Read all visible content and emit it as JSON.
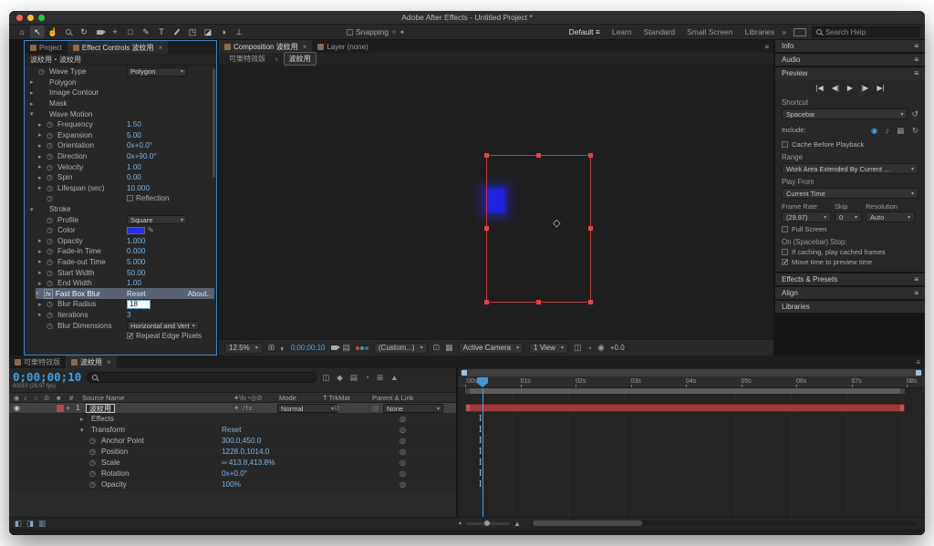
{
  "window": {
    "title": "Adobe After Effects - Untitled Project *"
  },
  "icons": {
    "panel-menu": "≡",
    "close": "×",
    "chevron-down": "▾",
    "chevron-right": "▸",
    "chevron-left": "‹",
    "overflow": "»",
    "stopwatch": "◷",
    "pickwhip": "◎",
    "link": "∞",
    "reset": "↺",
    "eye": "◉",
    "audio": "♪",
    "solo": "○",
    "lock": "⊘",
    "label": "■",
    "overlays": "▦",
    "refresh": "↻",
    "eyedropper": "✎",
    "fx-badge": "fx",
    "switches": "✦\\fx◔◎⊘",
    "layer-switches": "✦ /fx",
    "anchor-star": "◇",
    "grid": "⊞",
    "mask-vis": "◐",
    "show-snapshot": "▤",
    "roi": "⊡",
    "tgrid": "▦",
    "pixel-aspect": "◫",
    "fast-previews": "◔",
    "aperture": "◉",
    "snap-a": "✧",
    "snap-b": "✦"
  },
  "toolbar": {
    "tools": [
      {
        "name": "home-tool",
        "glyph": "⌂"
      },
      {
        "name": "selection-tool",
        "glyph": "↖",
        "active": true
      },
      {
        "name": "hand-tool",
        "glyph": "☝"
      },
      {
        "name": "zoom-tool",
        "shape": "mag"
      },
      {
        "name": "orbit-camera-tool",
        "glyph": "↻"
      },
      {
        "name": "camera-tool",
        "shape": "cam"
      },
      {
        "name": "pan-behind-tool",
        "glyph": "+"
      },
      {
        "name": "shape-tool",
        "glyph": "□"
      },
      {
        "name": "pen-tool",
        "glyph": "✎"
      },
      {
        "name": "type-tool",
        "glyph": "T"
      },
      {
        "name": "brush-tool",
        "shape": "brush"
      },
      {
        "name": "clone-stamp-tool",
        "glyph": "◳"
      },
      {
        "name": "eraser-tool",
        "glyph": "◪"
      },
      {
        "name": "roto-brush-tool",
        "glyph": "◑"
      },
      {
        "name": "puppet-pin-tool",
        "glyph": "⊥"
      }
    ],
    "snapping_label": "Snapping",
    "workspaces": [
      {
        "label": "Default",
        "active": true
      },
      {
        "label": "Learn"
      },
      {
        "label": "Standard"
      },
      {
        "label": "Small Screen"
      },
      {
        "label": "Libraries"
      }
    ],
    "search_placeholder": "Search Help"
  },
  "effect_controls": {
    "tabs": [
      {
        "label": "Project",
        "active": false
      },
      {
        "label": "Effect Controls 波紋用",
        "active": true
      }
    ],
    "breadcrumb": "波紋用・波紋用",
    "rows": [
      {
        "sw": true,
        "label": "Wave Type",
        "value": "Polygon",
        "kind": "dropdown"
      },
      {
        "arrow": "r",
        "label": "Polygon",
        "kind": "group"
      },
      {
        "arrow": "r",
        "label": "Image Contour",
        "kind": "group"
      },
      {
        "arrow": "r",
        "label": "Mask",
        "kind": "group"
      },
      {
        "arrow": "d",
        "label": "Wave Motion",
        "kind": "group"
      },
      {
        "indent": 1,
        "arrow": "r",
        "sw": true,
        "label": "Frequency",
        "value": "1.50",
        "kind": "value"
      },
      {
        "indent": 1,
        "arrow": "r",
        "sw": true,
        "label": "Expansion",
        "value": "5.00",
        "kind": "value"
      },
      {
        "indent": 1,
        "arrow": "r",
        "sw": true,
        "label": "Orientation",
        "value": "0x+0.0°",
        "kind": "value"
      },
      {
        "indent": 1,
        "arrow": "r",
        "sw": true,
        "label": "Direction",
        "value": "0x+90.0°",
        "kind": "value"
      },
      {
        "indent": 1,
        "arrow": "r",
        "sw": true,
        "label": "Velocity",
        "value": "1.00",
        "kind": "value"
      },
      {
        "indent": 1,
        "arrow": "r",
        "sw": true,
        "label": "Spin",
        "value": "0.00",
        "kind": "value"
      },
      {
        "indent": 1,
        "arrow": "r",
        "sw": true,
        "label": "Lifespan (sec)",
        "value": "10.000",
        "kind": "value"
      },
      {
        "indent": 1,
        "sw": true,
        "label": "",
        "value": "Reflection",
        "kind": "checkbox",
        "checked": false
      },
      {
        "arrow": "d",
        "label": "Stroke",
        "kind": "group"
      },
      {
        "indent": 1,
        "sw": true,
        "label": "Profile",
        "value": "Square",
        "kind": "dropdown"
      },
      {
        "indent": 1,
        "sw": true,
        "label": "Color",
        "kind": "color",
        "color": "#2230e8"
      },
      {
        "indent": 1,
        "arrow": "r",
        "sw": true,
        "label": "Opacity",
        "value": "1.000",
        "kind": "value"
      },
      {
        "indent": 1,
        "arrow": "r",
        "sw": true,
        "label": "Fade-in Time",
        "value": "0.000",
        "kind": "value"
      },
      {
        "indent": 1,
        "arrow": "r",
        "sw": true,
        "label": "Fade-out Time",
        "value": "5.000",
        "kind": "value"
      },
      {
        "indent": 1,
        "arrow": "r",
        "sw": true,
        "label": "Start Width",
        "value": "50.00",
        "kind": "value"
      },
      {
        "indent": 1,
        "arrow": "r",
        "sw": true,
        "label": "End Width",
        "value": "1.00",
        "kind": "value"
      },
      {
        "kind": "fxheader",
        "label": "Fast Box Blur",
        "reset": "Reset",
        "about": "About.."
      },
      {
        "indent": 1,
        "arrow": "r",
        "sw": true,
        "label": "Blur Radius",
        "value": "18",
        "kind": "edit"
      },
      {
        "indent": 1,
        "arrow": "r",
        "sw": true,
        "label": "Iterations",
        "value": "3",
        "kind": "value"
      },
      {
        "indent": 1,
        "sw": true,
        "label": "Blur Dimensions",
        "value": "Horizontal and Vert",
        "kind": "dropdown"
      },
      {
        "indent": 1,
        "label": "",
        "value": "Repeat Edge Pixels",
        "kind": "checkbox",
        "checked": true
      }
    ]
  },
  "composition": {
    "tabs": [
      {
        "label": "Composition 波紋用",
        "active": true
      },
      {
        "label": "Layer (none)",
        "active": false
      }
    ],
    "viewer_tabs": [
      "可樂特效版",
      "波紋用"
    ],
    "active_viewer_tab": "波紋用",
    "toolbar": {
      "magnification": "12.5%",
      "timecode": "0;00;00;10",
      "resolution": "(Custom...)",
      "camera": "Active Camera",
      "view_layout": "1 View",
      "exposure": "+0.0"
    }
  },
  "right_panels": {
    "info": "Info",
    "audio": "Audio",
    "preview": {
      "title": "Preview",
      "transport": [
        {
          "name": "first-frame-button",
          "glyph": "|◀"
        },
        {
          "name": "previous-frame-button",
          "glyph": "◀|"
        },
        {
          "name": "play-button",
          "glyph": "▶"
        },
        {
          "name": "next-frame-button",
          "glyph": "|▶"
        },
        {
          "name": "last-frame-button",
          "glyph": "▶|"
        }
      ],
      "shortcut_label": "Shortcut",
      "shortcut_value": "Spacebar",
      "include_label": "Include:",
      "cache_label": "Cache Before Playback",
      "range_label": "Range",
      "range_value": "Work Area Extended By Current …",
      "play_from_label": "Play From",
      "play_from_value": "Current Time",
      "frame_rate_label": "Frame Rate",
      "skip_label": "Skip",
      "resolution_label": "Resolution",
      "frame_rate_value": "(29.97)",
      "skip_value": "0",
      "resolution_value": "Auto",
      "full_screen_label": "Full Screen",
      "stop_label": "On (Spacebar) Stop:",
      "caching_label": "If caching, play cached frames",
      "move_time_label": "Move time to preview time"
    },
    "effects_presets": "Effects & Presets",
    "align": "Align",
    "libraries": "Libraries"
  },
  "timeline": {
    "tabs": [
      {
        "label": "可樂特效版",
        "active": false
      },
      {
        "label": "波紋用",
        "active": true
      }
    ],
    "timecode": "0;00;00;10",
    "frame_info": "00010 (29.97 fps)",
    "header_icons": [
      {
        "name": "composition-flowchart-icon",
        "glyph": "◫"
      },
      {
        "name": "mini-flowchart-icon",
        "glyph": "◆"
      },
      {
        "name": "shy-layers-icon",
        "glyph": "▤"
      },
      {
        "name": "frame-blending-icon",
        "glyph": "◔"
      },
      {
        "name": "motion-blur-icon",
        "glyph": "⊞"
      },
      {
        "name": "graph-editor-icon",
        "glyph": "▲"
      }
    ],
    "columns": {
      "hash": "#",
      "source_name": "Source Name",
      "mode": "Mode",
      "trkmat": "T TrkMat",
      "parent": "Parent & Link"
    },
    "layer": {
      "number": "1",
      "name": "波紋用",
      "mode": "Normal",
      "parent": "None"
    },
    "rows": [
      {
        "kind": "group",
        "arrow": "r",
        "label": "Effects"
      },
      {
        "kind": "group",
        "arrow": "d",
        "label": "Transform",
        "value": "Reset"
      },
      {
        "kind": "prop",
        "label": "Anchor Point",
        "value": "300.0,450.0"
      },
      {
        "kind": "prop",
        "label": "Position",
        "value": "1228.0,1014.0"
      },
      {
        "kind": "prop",
        "label": "Scale",
        "value": "413.8,413.8%",
        "link": true
      },
      {
        "kind": "prop",
        "label": "Rotation",
        "value": "0x+0.0°"
      },
      {
        "kind": "prop",
        "label": "Opacity",
        "value": "100%"
      }
    ],
    "ruler_labels": [
      ":00s",
      "01s",
      "02s",
      "03s",
      "04s",
      "05s",
      "06s",
      "07s",
      "08s"
    ]
  },
  "colors": {
    "accent_blue": "#4fa3e0",
    "value_blue": "#7cb0e2",
    "timecode_blue": "#3fa0e8",
    "selection_red": "#e04545",
    "layer_bar_red": "#9e3a3a",
    "stroke_color_swatch": "#2230e8",
    "focus_border": "#3d85c6"
  }
}
